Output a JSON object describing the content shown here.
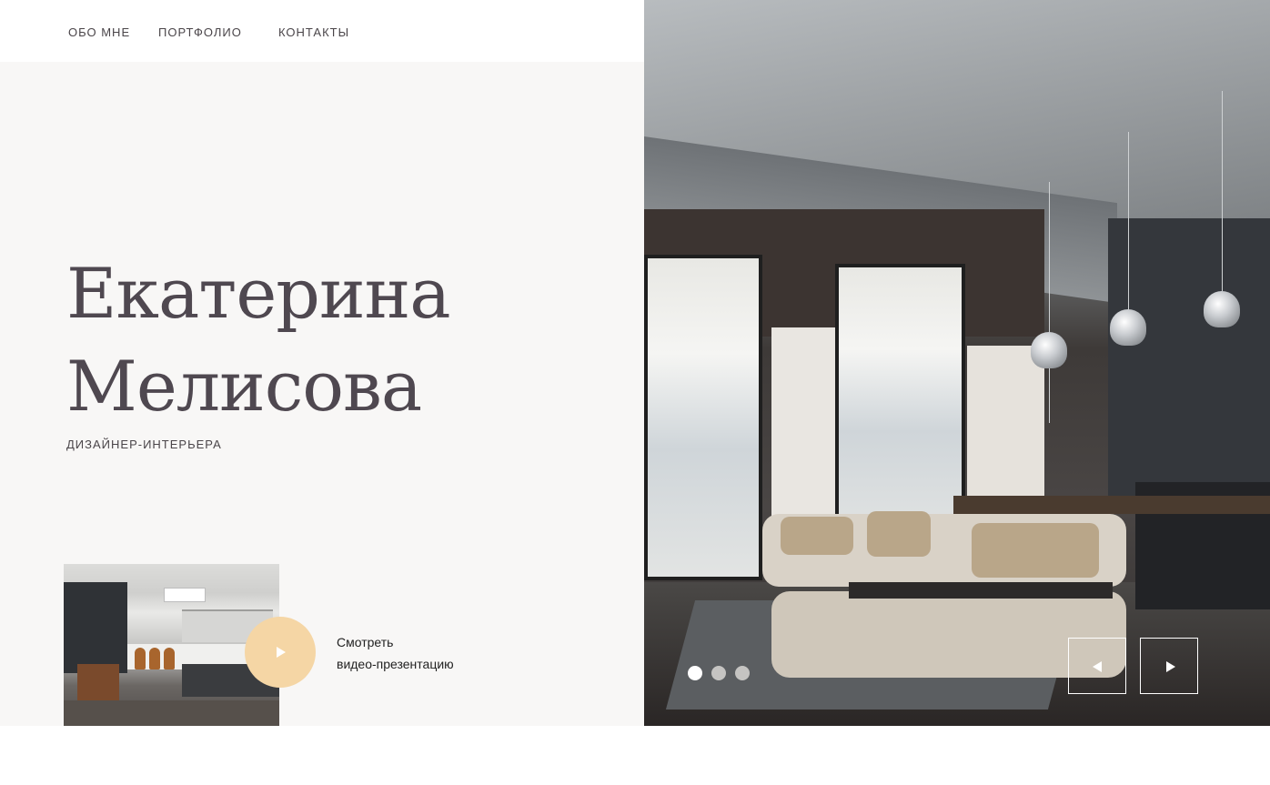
{
  "nav": {
    "items": [
      {
        "label": "ОБО МНЕ"
      },
      {
        "label": "ПОРТФОЛИО"
      },
      {
        "label": "КОНТАКТЫ"
      }
    ]
  },
  "hero": {
    "first_name": "Екатерина",
    "last_name": "Мелисова",
    "subtitle": "ДИЗАЙНЕР-ИНТЕРЬЕРА"
  },
  "video": {
    "line1": "Смотреть",
    "line2": "видео-презентацию",
    "play_icon": "play-icon"
  },
  "slider": {
    "total_slides": 3,
    "active_slide": 1,
    "prev_icon": "arrow-left-icon",
    "next_icon": "arrow-right-icon"
  },
  "colors": {
    "accent": "#f5d6a5",
    "title": "#4f4850",
    "panel_bg": "#f8f7f6"
  }
}
